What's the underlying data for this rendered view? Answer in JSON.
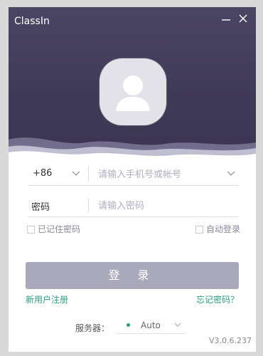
{
  "window": {
    "title": "ClassIn"
  },
  "login": {
    "country_code": "+86",
    "phone_placeholder": "请输入手机号或帐号",
    "password_label": "密码",
    "password_placeholder": "请输入密码",
    "remember_password": "已记住密码",
    "auto_login": "自动登录",
    "login_button": "登 录",
    "register_link": "新用户注册",
    "forgot_link": "忘记密码？"
  },
  "server": {
    "label": "服务器：",
    "value": "Auto"
  },
  "version": "V3.0.6.237",
  "colors": {
    "header": "#423d5a",
    "button": "#aaa8bb",
    "link": "#2aa07b"
  },
  "icons": {
    "minimize": "minimize-icon",
    "close": "close-icon",
    "avatar": "user-avatar-icon",
    "dropdown": "chevron-down-icon"
  }
}
